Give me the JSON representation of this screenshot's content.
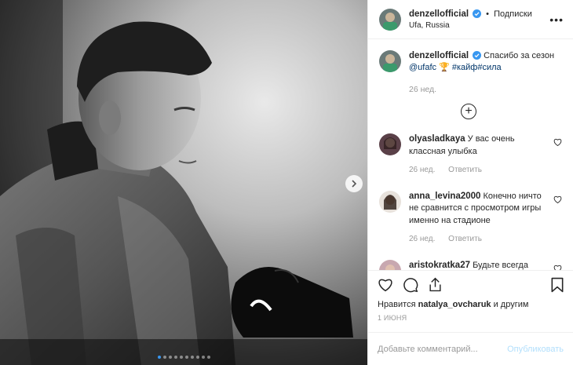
{
  "post": {
    "author": "denzellofficial",
    "separator": "•",
    "follow_label": "Подписки",
    "location": "Ufa, Russia",
    "more_label": "•••"
  },
  "caption": {
    "author": "denzellofficial",
    "text": "Спасибо за сезон",
    "mention": "@ufafc",
    "trophy": "🏆",
    "hashtags": "#кайф#сила",
    "time": "26 нед."
  },
  "load_more_label": "+",
  "comments": [
    {
      "user": "olyasladkaya",
      "text": "У вас очень классная улыбка",
      "time": "26 нед.",
      "reply": "Ответить"
    },
    {
      "user": "anna_levina2000",
      "text": "Конечно ничто не сравнится с просмотром игры именно на стадионе",
      "time": "26 нед.",
      "reply": "Ответить"
    },
    {
      "user": "aristokratka27",
      "text": "Будьте всегда",
      "time": "",
      "reply": ""
    }
  ],
  "likes": {
    "prefix": "Нравится",
    "user": "natalya_ovcharuk",
    "suffix": "и другим"
  },
  "date": "1 ИЮНЯ",
  "add_comment": {
    "placeholder": "Добавьте комментарий...",
    "publish_label": "Опубликовать"
  },
  "carousel": {
    "slides": 10,
    "active_index": 0
  },
  "colors": {
    "accent": "#3897f0",
    "verified": "#3897f0",
    "publish_disabled": "#b2dffc",
    "muted": "#999999"
  }
}
